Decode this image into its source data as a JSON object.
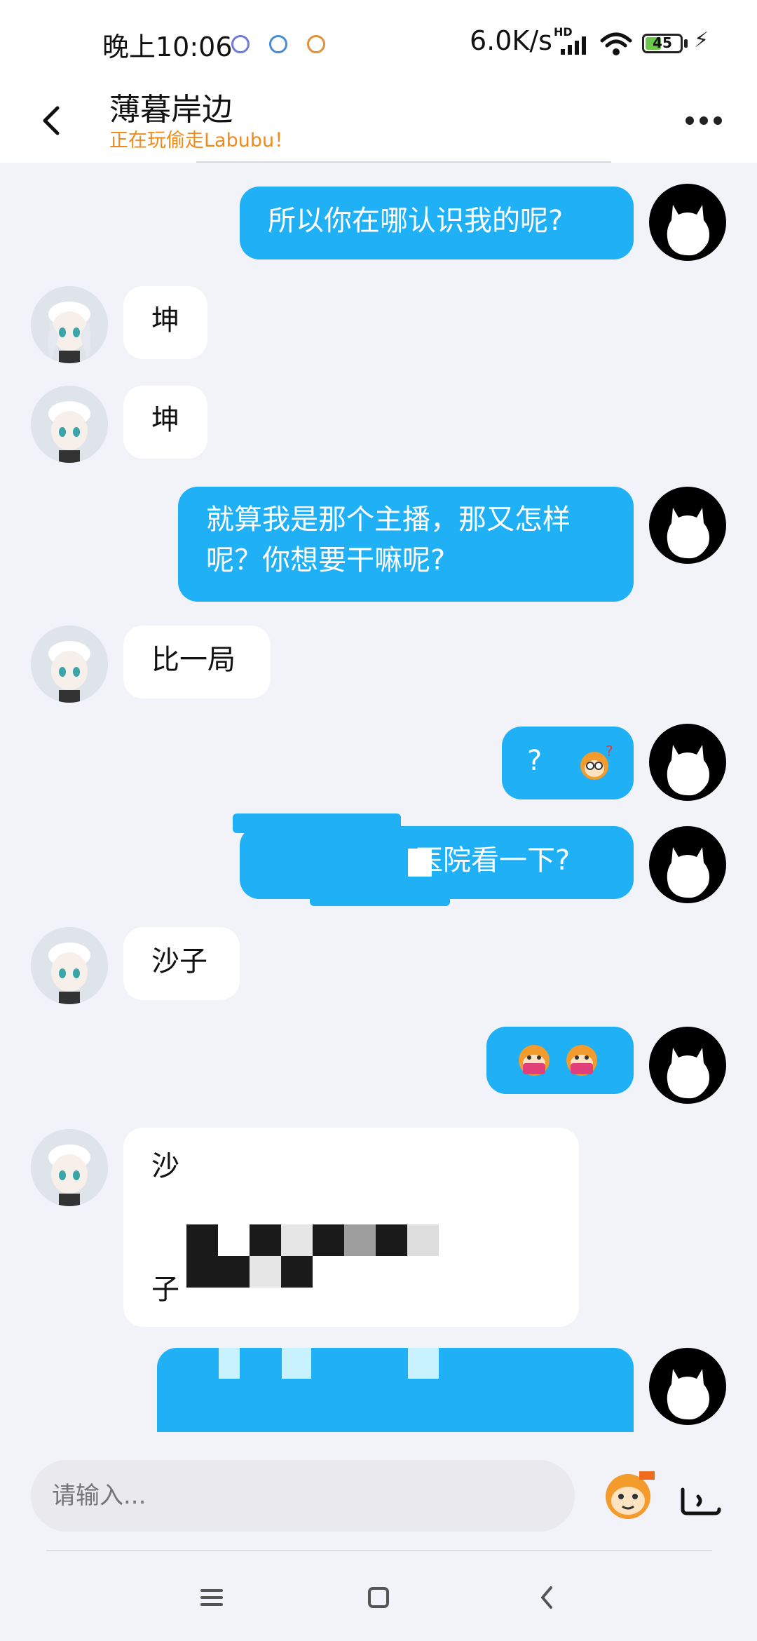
{
  "status_bar": {
    "time": "晚上10:06",
    "net_speed": "6.0K/s",
    "hd": "HD",
    "battery_level": 45,
    "battery_text": "45"
  },
  "header": {
    "contact_name": "薄暮岸边",
    "contact_status": "正在玩偷走Labubu！"
  },
  "messages": [
    {
      "sender": "self",
      "text": "所以你在哪认识我的呢?"
    },
    {
      "sender": "other",
      "text": "坤"
    },
    {
      "sender": "other",
      "text": "坤"
    },
    {
      "sender": "self",
      "line1": "就算我是那个主播，那又怎样",
      "line2": "呢？你想要干嘛呢?"
    },
    {
      "sender": "other",
      "text": "比一局"
    },
    {
      "sender": "self",
      "text": "?",
      "sticker": "confused-monkey-emoji"
    },
    {
      "sender": "self",
      "text_visible": "医院看一下?",
      "censored": true
    },
    {
      "sender": "other",
      "text": "沙子"
    },
    {
      "sender": "self",
      "sticker": "eating-monkey-emoji"
    },
    {
      "sender": "other",
      "text_visible_1": "沙",
      "text_visible_2": "子",
      "censored": true
    },
    {
      "sender": "self",
      "censored": true
    }
  ],
  "input": {
    "placeholder": "请输入..."
  },
  "colors": {
    "self_bubble": "#1fb0f5",
    "other_bubble": "#ffffff",
    "status_accent": "#f08a1c",
    "background": "#f2f3f8"
  },
  "icons": {
    "back": "back-arrow-icon",
    "more": "more-dots-icon",
    "emoji": "monkey-emoji-icon",
    "voice": "voice-icon",
    "nav_menu": "menu-icon",
    "nav_home": "home-square-icon",
    "nav_back": "back-chevron-icon"
  }
}
